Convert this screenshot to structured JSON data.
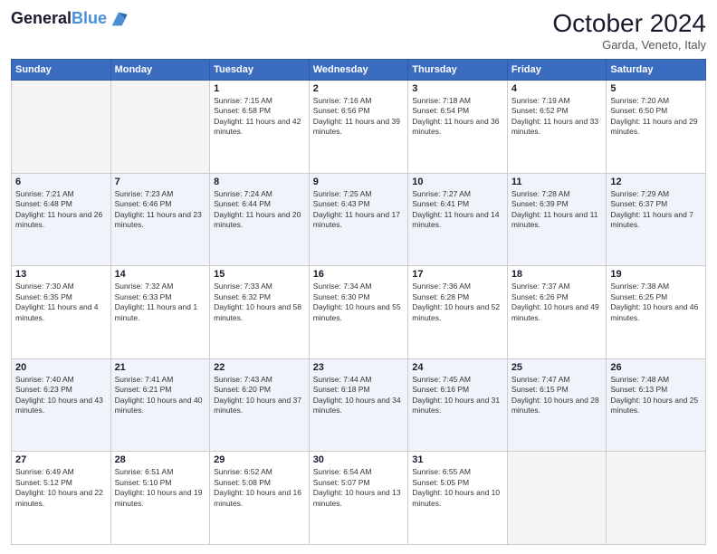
{
  "logo": {
    "line1": "General",
    "line2": "Blue"
  },
  "title": "October 2024",
  "location": "Garda, Veneto, Italy",
  "days_of_week": [
    "Sunday",
    "Monday",
    "Tuesday",
    "Wednesday",
    "Thursday",
    "Friday",
    "Saturday"
  ],
  "weeks": [
    [
      {
        "day": "",
        "empty": true
      },
      {
        "day": "",
        "empty": true
      },
      {
        "day": "1",
        "sunrise": "Sunrise: 7:15 AM",
        "sunset": "Sunset: 6:58 PM",
        "daylight": "Daylight: 11 hours and 42 minutes."
      },
      {
        "day": "2",
        "sunrise": "Sunrise: 7:16 AM",
        "sunset": "Sunset: 6:56 PM",
        "daylight": "Daylight: 11 hours and 39 minutes."
      },
      {
        "day": "3",
        "sunrise": "Sunrise: 7:18 AM",
        "sunset": "Sunset: 6:54 PM",
        "daylight": "Daylight: 11 hours and 36 minutes."
      },
      {
        "day": "4",
        "sunrise": "Sunrise: 7:19 AM",
        "sunset": "Sunset: 6:52 PM",
        "daylight": "Daylight: 11 hours and 33 minutes."
      },
      {
        "day": "5",
        "sunrise": "Sunrise: 7:20 AM",
        "sunset": "Sunset: 6:50 PM",
        "daylight": "Daylight: 11 hours and 29 minutes."
      }
    ],
    [
      {
        "day": "6",
        "sunrise": "Sunrise: 7:21 AM",
        "sunset": "Sunset: 6:48 PM",
        "daylight": "Daylight: 11 hours and 26 minutes."
      },
      {
        "day": "7",
        "sunrise": "Sunrise: 7:23 AM",
        "sunset": "Sunset: 6:46 PM",
        "daylight": "Daylight: 11 hours and 23 minutes."
      },
      {
        "day": "8",
        "sunrise": "Sunrise: 7:24 AM",
        "sunset": "Sunset: 6:44 PM",
        "daylight": "Daylight: 11 hours and 20 minutes."
      },
      {
        "day": "9",
        "sunrise": "Sunrise: 7:25 AM",
        "sunset": "Sunset: 6:43 PM",
        "daylight": "Daylight: 11 hours and 17 minutes."
      },
      {
        "day": "10",
        "sunrise": "Sunrise: 7:27 AM",
        "sunset": "Sunset: 6:41 PM",
        "daylight": "Daylight: 11 hours and 14 minutes."
      },
      {
        "day": "11",
        "sunrise": "Sunrise: 7:28 AM",
        "sunset": "Sunset: 6:39 PM",
        "daylight": "Daylight: 11 hours and 11 minutes."
      },
      {
        "day": "12",
        "sunrise": "Sunrise: 7:29 AM",
        "sunset": "Sunset: 6:37 PM",
        "daylight": "Daylight: 11 hours and 7 minutes."
      }
    ],
    [
      {
        "day": "13",
        "sunrise": "Sunrise: 7:30 AM",
        "sunset": "Sunset: 6:35 PM",
        "daylight": "Daylight: 11 hours and 4 minutes."
      },
      {
        "day": "14",
        "sunrise": "Sunrise: 7:32 AM",
        "sunset": "Sunset: 6:33 PM",
        "daylight": "Daylight: 11 hours and 1 minute."
      },
      {
        "day": "15",
        "sunrise": "Sunrise: 7:33 AM",
        "sunset": "Sunset: 6:32 PM",
        "daylight": "Daylight: 10 hours and 58 minutes."
      },
      {
        "day": "16",
        "sunrise": "Sunrise: 7:34 AM",
        "sunset": "Sunset: 6:30 PM",
        "daylight": "Daylight: 10 hours and 55 minutes."
      },
      {
        "day": "17",
        "sunrise": "Sunrise: 7:36 AM",
        "sunset": "Sunset: 6:28 PM",
        "daylight": "Daylight: 10 hours and 52 minutes."
      },
      {
        "day": "18",
        "sunrise": "Sunrise: 7:37 AM",
        "sunset": "Sunset: 6:26 PM",
        "daylight": "Daylight: 10 hours and 49 minutes."
      },
      {
        "day": "19",
        "sunrise": "Sunrise: 7:38 AM",
        "sunset": "Sunset: 6:25 PM",
        "daylight": "Daylight: 10 hours and 46 minutes."
      }
    ],
    [
      {
        "day": "20",
        "sunrise": "Sunrise: 7:40 AM",
        "sunset": "Sunset: 6:23 PM",
        "daylight": "Daylight: 10 hours and 43 minutes."
      },
      {
        "day": "21",
        "sunrise": "Sunrise: 7:41 AM",
        "sunset": "Sunset: 6:21 PM",
        "daylight": "Daylight: 10 hours and 40 minutes."
      },
      {
        "day": "22",
        "sunrise": "Sunrise: 7:43 AM",
        "sunset": "Sunset: 6:20 PM",
        "daylight": "Daylight: 10 hours and 37 minutes."
      },
      {
        "day": "23",
        "sunrise": "Sunrise: 7:44 AM",
        "sunset": "Sunset: 6:18 PM",
        "daylight": "Daylight: 10 hours and 34 minutes."
      },
      {
        "day": "24",
        "sunrise": "Sunrise: 7:45 AM",
        "sunset": "Sunset: 6:16 PM",
        "daylight": "Daylight: 10 hours and 31 minutes."
      },
      {
        "day": "25",
        "sunrise": "Sunrise: 7:47 AM",
        "sunset": "Sunset: 6:15 PM",
        "daylight": "Daylight: 10 hours and 28 minutes."
      },
      {
        "day": "26",
        "sunrise": "Sunrise: 7:48 AM",
        "sunset": "Sunset: 6:13 PM",
        "daylight": "Daylight: 10 hours and 25 minutes."
      }
    ],
    [
      {
        "day": "27",
        "sunrise": "Sunrise: 6:49 AM",
        "sunset": "Sunset: 5:12 PM",
        "daylight": "Daylight: 10 hours and 22 minutes."
      },
      {
        "day": "28",
        "sunrise": "Sunrise: 6:51 AM",
        "sunset": "Sunset: 5:10 PM",
        "daylight": "Daylight: 10 hours and 19 minutes."
      },
      {
        "day": "29",
        "sunrise": "Sunrise: 6:52 AM",
        "sunset": "Sunset: 5:08 PM",
        "daylight": "Daylight: 10 hours and 16 minutes."
      },
      {
        "day": "30",
        "sunrise": "Sunrise: 6:54 AM",
        "sunset": "Sunset: 5:07 PM",
        "daylight": "Daylight: 10 hours and 13 minutes."
      },
      {
        "day": "31",
        "sunrise": "Sunrise: 6:55 AM",
        "sunset": "Sunset: 5:05 PM",
        "daylight": "Daylight: 10 hours and 10 minutes."
      },
      {
        "day": "",
        "empty": true
      },
      {
        "day": "",
        "empty": true
      }
    ]
  ]
}
